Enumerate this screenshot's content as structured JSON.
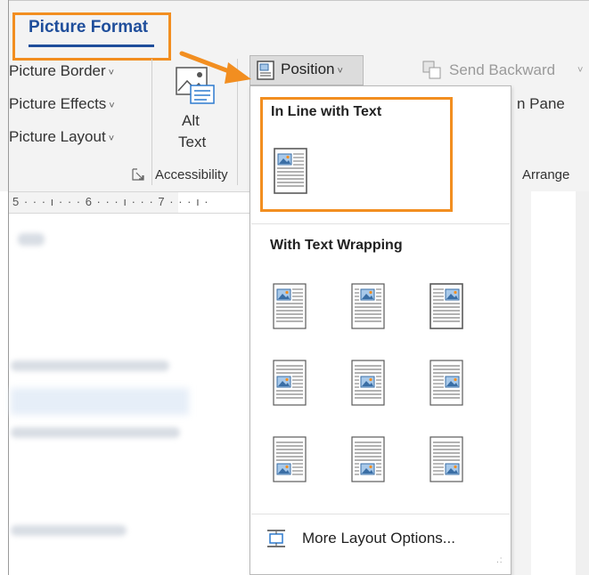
{
  "ribbon": {
    "tab_label": "Picture Format",
    "picture_border": "Picture Border",
    "picture_effects": "Picture Effects",
    "picture_layout": "Picture Layout",
    "alt_text_line1": "Alt",
    "alt_text_line2": "Text",
    "group_accessibility": "Accessibility",
    "position_label": "Position",
    "send_backward": "Send Backward",
    "pane_label": "n Pane",
    "group_arrange": "Arrange",
    "dropdown_chevron": "˅"
  },
  "ruler": {
    "text": "5 · · · ı · · · 6 · · · ı · · · 7 · · · ı ·"
  },
  "dropdown": {
    "inline_heading": "In Line with Text",
    "wrap_heading": "With Text Wrapping",
    "more_layout_options": "More Layout Options...",
    "inline_option": {
      "image": "top-left",
      "framed": true
    },
    "wrap_options": [
      {
        "position": "top-left"
      },
      {
        "position": "top-center"
      },
      {
        "position": "top-right"
      },
      {
        "position": "middle-left"
      },
      {
        "position": "middle-center"
      },
      {
        "position": "middle-right"
      },
      {
        "position": "bottom-left"
      },
      {
        "position": "bottom-center"
      },
      {
        "position": "bottom-right"
      }
    ]
  },
  "icons": {
    "alt_text": "alt-text-icon",
    "position": "position-icon",
    "send_backward": "send-backward-icon",
    "more_layout": "layout-options-icon",
    "dialog_launcher": "dialog-launcher-icon"
  },
  "colors": {
    "highlight": "#f28e20",
    "tab_text": "#1f4e9b",
    "image_fill": "#a8c9ea",
    "image_border": "#3a6ea5"
  }
}
